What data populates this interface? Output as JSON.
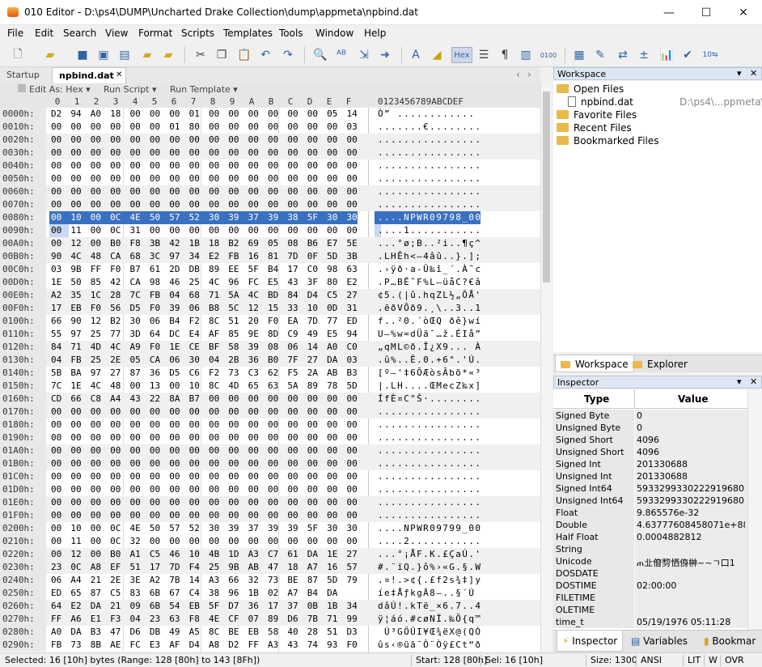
{
  "window": {
    "title": "010 Editor - D:\\ps4\\DUMP\\Uncharted Drake Collection\\dump\\appmeta\\npbind.dat",
    "minimize": "—",
    "maximize": "☐",
    "close": "✕"
  },
  "menu": [
    "File",
    "Edit",
    "Search",
    "View",
    "Format",
    "Scripts",
    "Templates",
    "Tools",
    "Window",
    "Help"
  ],
  "toolbar": {
    "hex_label": "Hex"
  },
  "tabs": {
    "startup": "Startup",
    "active": "npbind.dat",
    "close": "✕",
    "nav_left": "‹",
    "nav_right": "›",
    "nav_menu": "⌄"
  },
  "editor_head": {
    "edit_as": "Edit As: Hex ▾",
    "run_script": "Run Script ▾",
    "run_template": "Run Template ▾"
  },
  "columns": [
    "0",
    "1",
    "2",
    "3",
    "4",
    "5",
    "6",
    "7",
    "8",
    "9",
    "A",
    "B",
    "C",
    "D",
    "E",
    "F"
  ],
  "char_header": "0123456789ABCDEF",
  "rows": [
    {
      "a": "0000h:",
      "h": "D2 94 A0 18 00 00 00 01 00 00 00 00 00 00 05 14",
      "c": "Ò” ............"
    },
    {
      "a": "0010h:",
      "h": "00 00 00 00 00 00 01 80 00 00 00 00 00 00 00 03",
      "c": ".......€........"
    },
    {
      "a": "0020h:",
      "h": "00 00 00 00 00 00 00 00 00 00 00 00 00 00 00 00",
      "c": "................"
    },
    {
      "a": "0030h:",
      "h": "00 00 00 00 00 00 00 00 00 00 00 00 00 00 00 00",
      "c": "................"
    },
    {
      "a": "0040h:",
      "h": "00 00 00 00 00 00 00 00 00 00 00 00 00 00 00 00",
      "c": "................"
    },
    {
      "a": "0050h:",
      "h": "00 00 00 00 00 00 00 00 00 00 00 00 00 00 00 00",
      "c": "................"
    },
    {
      "a": "0060h:",
      "h": "00 00 00 00 00 00 00 00 00 00 00 00 00 00 00 00",
      "c": "................"
    },
    {
      "a": "0070h:",
      "h": "00 00 00 00 00 00 00 00 00 00 00 00 00 00 00 00",
      "c": "................"
    },
    {
      "a": "0080h:",
      "h": "00 10 00 0C 4E 50 57 52 30 39 37 39 38 5F 30 30",
      "c": "....NPWR09798_00",
      "sel": true
    },
    {
      "a": "0090h:",
      "h": "00 11 00 0C 31 00 00 00 00 00 00 00 00 00 00 00",
      "c": "....1...........",
      "soft": true
    },
    {
      "a": "00A0h:",
      "h": "00 12 00 B0 F8 3B 42 1B 18 B2 69 05 08 B6 E7 5E",
      "c": "...°ø;B..²i..¶ç^"
    },
    {
      "a": "00B0h:",
      "h": "90 4C 48 CA 68 3C 97 34 E2 FB 16 81 7D 0F 5D 3B",
      "c": ".LHÊh<—4âû..}.];"
    },
    {
      "a": "00C0h:",
      "h": "03 9B FF F0 B7 61 2D DB 89 EE 5F B4 17 C0 98 63",
      "c": ".›ÿð·a-Û‰î_´.À˜c"
    },
    {
      "a": "00D0h:",
      "h": "1E 50 85 42 CA 98 46 25 4C 96 FC E5 43 3F 80 E2",
      "c": ".P…BÊ˜F%L–üåC?€â"
    },
    {
      "a": "00E0h:",
      "h": "A2 35 1C 28 7C FB 04 68 71 5A 4C BD 84 D4 C5 27",
      "c": "¢5.(|û.hqZL½„ÔÅ'"
    },
    {
      "a": "00F0h:",
      "h": "17 EB F0 56 D5 F0 39 06 B8 5C 12 15 33 10 0D 31",
      "c": ".ëðVÕð9.¸\\..3..1"
    },
    {
      "a": "0100h:",
      "h": "66 90 12 B2 30 06 B4 F2 8C 51 20 F0 EA 7D 77 ED",
      "c": "f..²0.´òŒQ ðê}wí"
    },
    {
      "a": "0110h:",
      "h": "55 97 25 77 3D 64 DC E4 AF 85 9E 8D C9 49 E5 94",
      "c": "U—%w=dÜä¯…ž.ÉIå”"
    },
    {
      "a": "0120h:",
      "h": "84 71 4D 4C A9 F0 1E CE BF 58 39 08 06 14 A0 C0",
      "c": "„qML©ð.Î¿X9... À"
    },
    {
      "a": "0130h:",
      "h": "04 FB 25 2E 05 CA 06 30 04 2B 36 B0 7F 27 DA 03",
      "c": ".û%..Ê.0.+6°.'Ú."
    },
    {
      "a": "0140h:",
      "h": "5B BA 97 27 87 36 D5 C6 F2 73 C3 62 F5 2A AB B3",
      "c": "[º—'‡6ÕÆòsÃbõ*«³"
    },
    {
      "a": "0150h:",
      "h": "7C 1E 4C 48 00 13 00 10 8C 4D 65 63 5A 89 78 5D",
      "c": "|.LH....ŒMecZ‰x]"
    },
    {
      "a": "0160h:",
      "h": "CD 66 C8 A4 43 22 8A B7 00 00 00 00 00 00 00 00",
      "c": "ÍfÈ¤C\"Š·........"
    },
    {
      "a": "0170h:",
      "h": "00 00 00 00 00 00 00 00 00 00 00 00 00 00 00 00",
      "c": "................"
    },
    {
      "a": "0180h:",
      "h": "00 00 00 00 00 00 00 00 00 00 00 00 00 00 00 00",
      "c": "................"
    },
    {
      "a": "0190h:",
      "h": "00 00 00 00 00 00 00 00 00 00 00 00 00 00 00 00",
      "c": "................"
    },
    {
      "a": "01A0h:",
      "h": "00 00 00 00 00 00 00 00 00 00 00 00 00 00 00 00",
      "c": "................"
    },
    {
      "a": "01B0h:",
      "h": "00 00 00 00 00 00 00 00 00 00 00 00 00 00 00 00",
      "c": "................"
    },
    {
      "a": "01C0h:",
      "h": "00 00 00 00 00 00 00 00 00 00 00 00 00 00 00 00",
      "c": "................"
    },
    {
      "a": "01D0h:",
      "h": "00 00 00 00 00 00 00 00 00 00 00 00 00 00 00 00",
      "c": "................"
    },
    {
      "a": "01E0h:",
      "h": "00 00 00 00 00 00 00 00 00 00 00 00 00 00 00 00",
      "c": "................"
    },
    {
      "a": "01F0h:",
      "h": "00 00 00 00 00 00 00 00 00 00 00 00 00 00 00 00",
      "c": "................"
    },
    {
      "a": "0200h:",
      "h": "00 10 00 0C 4E 50 57 52 30 39 37 39 39 5F 30 30",
      "c": "....NPWR09799_00"
    },
    {
      "a": "0210h:",
      "h": "00 11 00 0C 32 00 00 00 00 00 00 00 00 00 00 00",
      "c": "....2..........."
    },
    {
      "a": "0220h:",
      "h": "00 12 00 B0 A1 C5 46 10 4B 1D A3 C7 61 DA 1E 27",
      "c": "...°¡ÅF.K.£ÇaÚ.'"
    },
    {
      "a": "0230h:",
      "h": "23 0C A8 EF 51 17 7D F4 25 9B AB 47 18 A7 16 57",
      "c": "#.¨ïQ.}ô%›«G.§.W"
    },
    {
      "a": "0240h:",
      "h": "06 A4 21 2E 3E A2 7B 14 A3 66 32 73 BE 87 5D 79",
      "c": ".¤!.>¢{.£f2s¾‡]y"
    },
    {
      "a": "0250h:",
      "h": "ED 65 87 C5 83 6B 67 C4 38 96 1B 02 A7 B4 DA",
      "c": "íe‡ÅƒkgÄ8–..§´Ú"
    },
    {
      "a": "0260h:",
      "h": "64 E2 DA 21 09 6B 54 EB 5F D7 36 17 37 0B 1B 34",
      "c": "dâÚ!.kTë_×6.7..4"
    },
    {
      "a": "0270h:",
      "h": "FF A6 E1 F3 04 23 63 F8 4E CF 07 89 D6 7B 71 99",
      "c": "ÿ¦áó.#cøNÏ.‰Ö{q™"
    },
    {
      "a": "0280h:",
      "h": "A0 DA B3 47 D6 DB 49 A5 8C BE EB 58 40 28 51 D3",
      "c": " Ú³GÖÛI¥Œ¾ëX@(QÓ"
    },
    {
      "a": "0290h:",
      "h": "FB 73 8B AE FC E3 AF D4 A8 D2 FF A3 43 74 93 F0",
      "c": "ûs‹®üã¯Ô¨Òÿ£Ct“ð"
    }
  ],
  "workspace": {
    "title": "Workspace",
    "open_files": "Open Files",
    "file": "npbind.dat",
    "file_path": "D:\\ps4\\...ppmeta\\",
    "favorite": "Favorite Files",
    "recent": "Recent Files",
    "bookmarked": "Bookmarked Files",
    "pin": "▾",
    "close": "✕"
  },
  "panel_tabs": {
    "workspace": "Workspace",
    "explorer": "Explorer"
  },
  "inspector": {
    "title": "Inspector",
    "col_type": "Type",
    "col_value": "Value",
    "rows": [
      {
        "t": "Signed Byte",
        "v": "0"
      },
      {
        "t": "Unsigned Byte",
        "v": "0"
      },
      {
        "t": "Signed Short",
        "v": "4096"
      },
      {
        "t": "Unsigned Short",
        "v": "4096"
      },
      {
        "t": "Signed Int",
        "v": "201330688"
      },
      {
        "t": "Unsigned Int",
        "v": "201330688"
      },
      {
        "t": "Signed Int64",
        "v": "5933299330222919680"
      },
      {
        "t": "Unsigned Int64",
        "v": "5933299330222919680"
      },
      {
        "t": "Float",
        "v": "9.865576e-32"
      },
      {
        "t": "Double",
        "v": "4.63777608458071e+88"
      },
      {
        "t": "Half Float",
        "v": "0.0004882812"
      },
      {
        "t": "String",
        "v": ""
      },
      {
        "t": "Unicode",
        "v": "ጠ㐀傄剓恓㑗榊~~ㄱ口1"
      },
      {
        "t": "DOSDATE",
        "v": ""
      },
      {
        "t": "DOSTIME",
        "v": "02:00:00"
      },
      {
        "t": "FILETIME",
        "v": ""
      },
      {
        "t": "OLETIME",
        "v": ""
      },
      {
        "t": "time_t",
        "v": "05/19/1976 05:11:28"
      }
    ]
  },
  "bottom_tabs": {
    "inspector": "Inspector",
    "variables": "Variables",
    "bookmarks": "Bookmar"
  },
  "status": {
    "selected": "Selected: 16 [10h] bytes (Range: 128 [80h] to 143 [8Fh])",
    "start": "Start: 128 [80h]",
    "sel": "Sel: 16 [10h]",
    "size": "Size: 1300",
    "encoding": "ANSI",
    "lit": "LIT",
    "w": "W",
    "ovr": "OVR"
  }
}
